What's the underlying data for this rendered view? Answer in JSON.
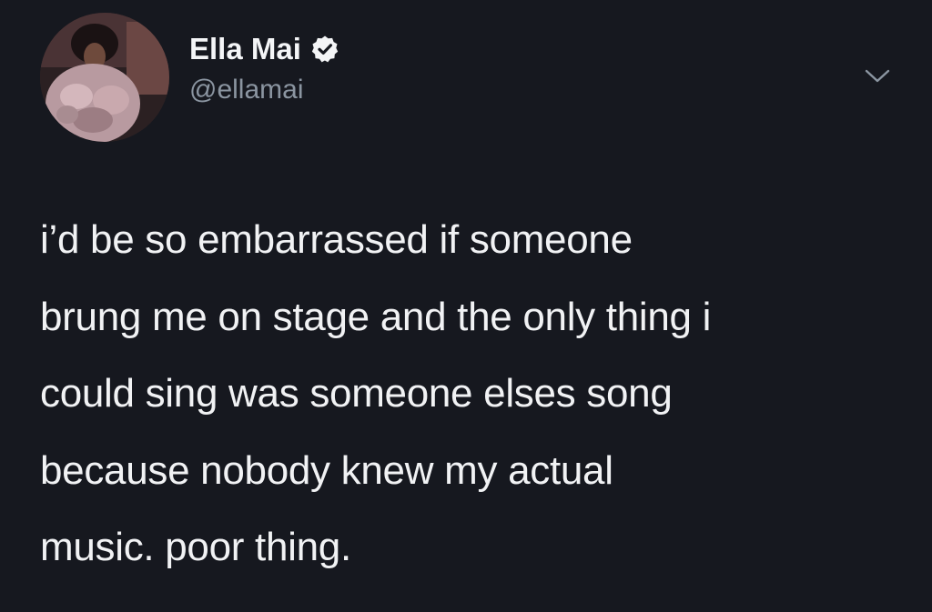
{
  "author": {
    "display_name": "Ella Mai",
    "handle": "@ellamai",
    "verified": true
  },
  "tweet": {
    "text": "i’d be so embarrassed if someone\nbrung me on stage and the only thing i\ncould sing was someone elses song\nbecause nobody knew my actual\nmusic. poor thing."
  },
  "icons": {
    "avatar": "profile-photo",
    "verified_badge": "verified-badge-icon",
    "menu": "chevron-down-icon"
  },
  "colors": {
    "background": "#16181f",
    "text": "#f1f2f4",
    "handle": "#8b95a1"
  }
}
